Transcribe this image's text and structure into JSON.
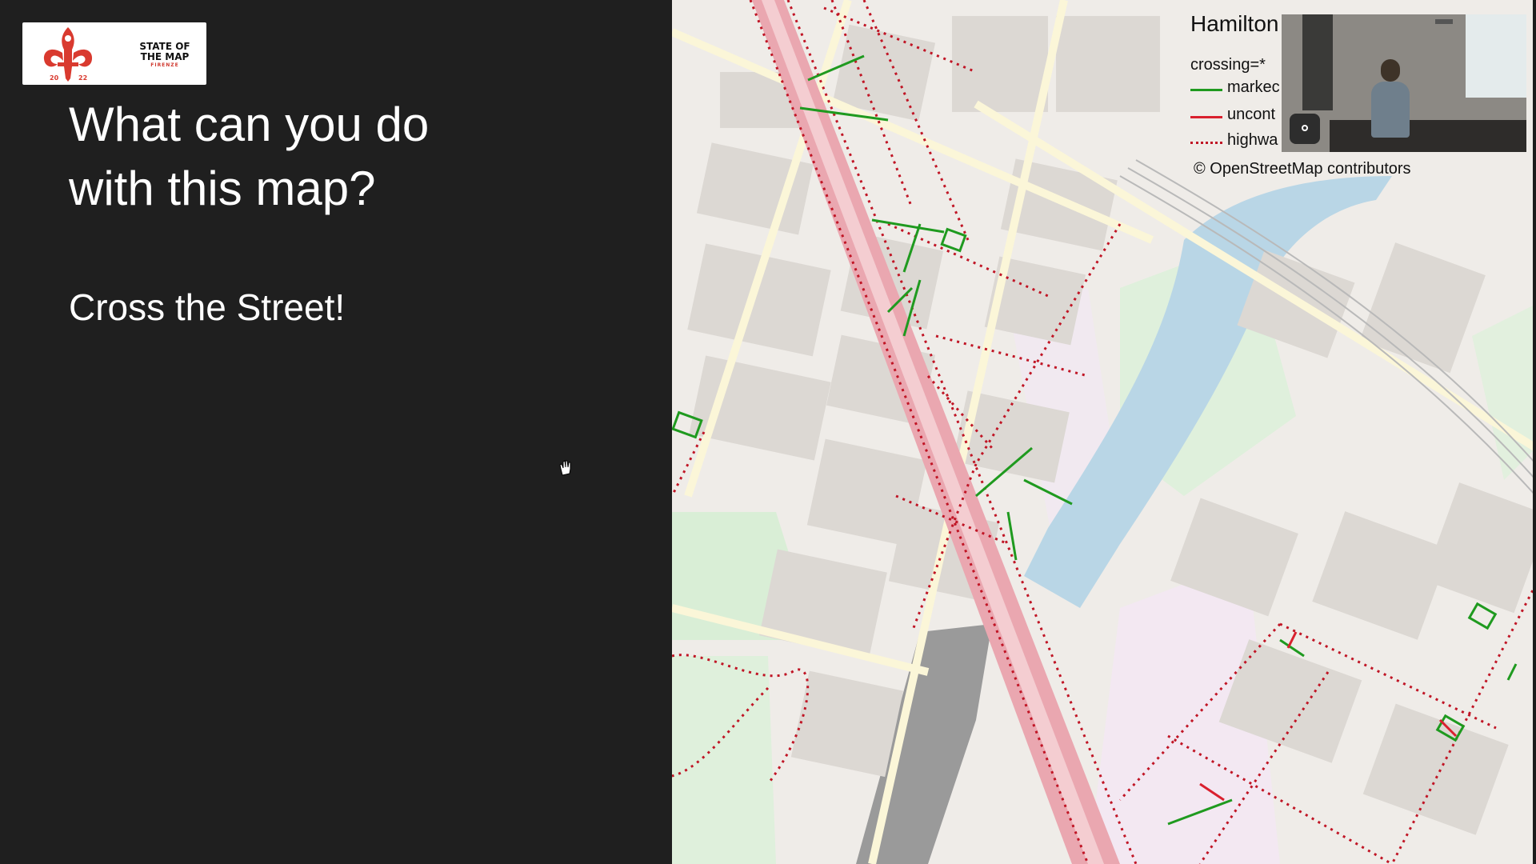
{
  "slide": {
    "logo": {
      "name_line1": "STATE OF",
      "name_line2": "THE MAP",
      "city": "FIRENZE",
      "year_left": "20",
      "year_right": "22"
    },
    "title_line1": "What can you do",
    "title_line2": "with this map?",
    "subtitle": "Cross the Street!"
  },
  "map": {
    "legend": {
      "title": "Hamilton",
      "tag": "crossing=*",
      "items": [
        {
          "label": "markec",
          "color": "#1f9a1f",
          "style": "solid"
        },
        {
          "label": "uncont",
          "color": "#d9202e",
          "style": "solid"
        },
        {
          "label": "highwa",
          "color": "#c01525",
          "style": "dotted"
        }
      ]
    },
    "attribution": "© OpenStreetMap contributors"
  },
  "colors": {
    "slide_bg": "#1f1f1f",
    "marked": "#1f9a1f",
    "uncontrolled": "#d9202e",
    "highway_dotted": "#c01525"
  }
}
